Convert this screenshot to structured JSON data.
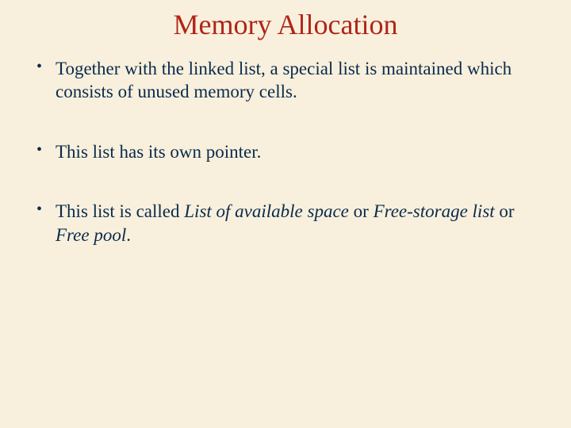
{
  "title": "Memory Allocation",
  "bullets": [
    {
      "segments": [
        {
          "text": "Together with the linked list, a special list is maintained which consists of unused memory cells.",
          "italic": false
        }
      ]
    },
    {
      "segments": [
        {
          "text": "This list has its own pointer.",
          "italic": false
        }
      ]
    },
    {
      "segments": [
        {
          "text": "This list is called ",
          "italic": false
        },
        {
          "text": "List of available space",
          "italic": true
        },
        {
          "text": " or ",
          "italic": false
        },
        {
          "text": "Free-storage list",
          "italic": true
        },
        {
          "text": " or ",
          "italic": false
        },
        {
          "text": "Free pool",
          "italic": true
        },
        {
          "text": ".",
          "italic": false
        }
      ]
    }
  ]
}
